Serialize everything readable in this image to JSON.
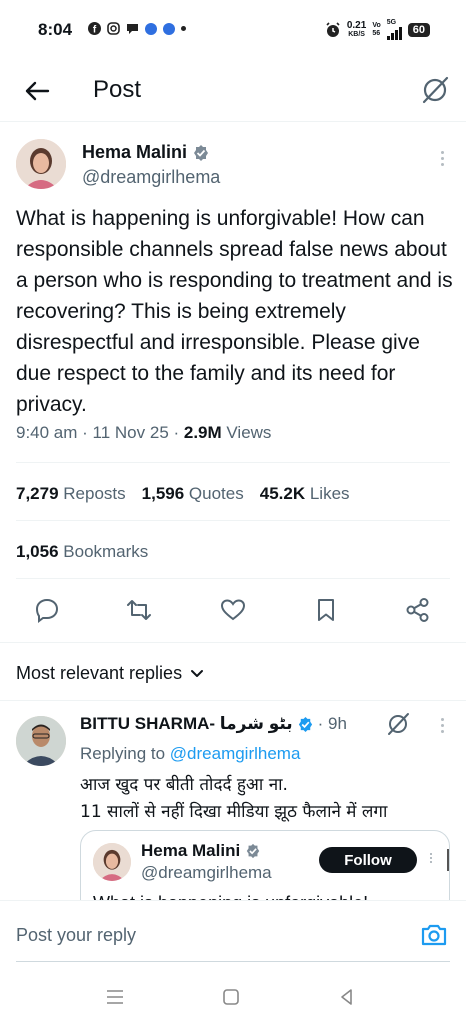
{
  "status_bar": {
    "time": "8:04",
    "net_speed_value": "0.21",
    "net_speed_unit": "KB/S",
    "volte_top": "Vo",
    "volte_bottom": "56",
    "network": "5G",
    "battery": "60"
  },
  "header": {
    "title": "Post",
    "back_icon": "arrow-left-icon",
    "grok_icon": "grok-icon"
  },
  "tweet": {
    "author_name": "Hema Malini",
    "author_handle": "@dreamgirlhema",
    "text": "What is happening is unforgivable! How can responsible channels spread false news about a person who is responding to treatment and is recovering? This is being extremely disrespectful and irresponsible. Please give due respect to the family and its need for privacy.",
    "time": "9:40 am · 11 Nov 25 · ",
    "views_count": "2.9M",
    "views_label": " Views"
  },
  "stats": {
    "reposts_count": "7,279",
    "reposts_label": " Reposts",
    "quotes_count": "1,596",
    "quotes_label": " Quotes",
    "likes_count": "45.2K",
    "likes_label": " Likes",
    "bookmarks_count": "1,056",
    "bookmarks_label": " Bookmarks"
  },
  "actions": [
    "reply-icon",
    "repost-icon",
    "like-icon",
    "bookmark-icon",
    "share-icon"
  ],
  "replies_filter": {
    "label": "Most relevant replies"
  },
  "reply": {
    "author_name": "BITTU SHARMA- بٹو شرما",
    "time": " · 9h",
    "replying_prefix": "Replying to ",
    "replying_handle": "@dreamgirlhema",
    "line1": "आज खुद पर बीती तोदर्द हुआ ना.",
    "line2": "11 सालों से नहीं दिखा मीडिया झूठ फैलाने में लगा"
  },
  "quote": {
    "author_name": "Hema Malini",
    "author_handle": "@dreamgirlhema",
    "follow_label": "Follow",
    "text_preview": "What is happening is unforgivable!"
  },
  "reply_bar": {
    "placeholder": "Post your reply"
  },
  "colors": {
    "verified": "#7c8a96",
    "link": "#1d9bf0",
    "secondary_text": "#536471"
  }
}
